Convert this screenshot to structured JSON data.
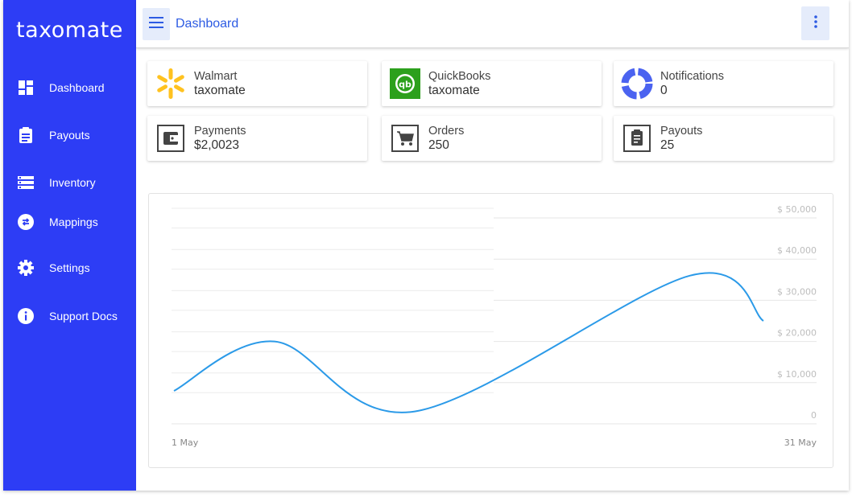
{
  "brand": {
    "logo_text": "taxomate"
  },
  "sidebar": {
    "items": [
      {
        "label": "Dashboard",
        "icon": "dashboard-icon"
      },
      {
        "label": "Payouts",
        "icon": "clipboard-icon"
      },
      {
        "label": "Inventory",
        "icon": "list-icon"
      },
      {
        "label": "Mappings",
        "icon": "swap-icon"
      },
      {
        "label": "Settings",
        "icon": "gear-icon"
      },
      {
        "label": "Support Docs",
        "icon": "info-icon"
      }
    ]
  },
  "header": {
    "title": "Dashboard"
  },
  "cards": [
    {
      "title": "Walmart",
      "value": "taxomate",
      "icon": "walmart-spark-icon"
    },
    {
      "title": "QuickBooks",
      "value": "taxomate",
      "icon": "quickbooks-icon"
    },
    {
      "title": "Notifications",
      "value": "0",
      "icon": "taxomate-logo-icon"
    },
    {
      "title": "Payments",
      "value": "$2,0023",
      "icon": "wallet-icon"
    },
    {
      "title": "Orders",
      "value": "250",
      "icon": "cart-icon"
    },
    {
      "title": "Payouts",
      "value": "25",
      "icon": "clipboard-icon"
    }
  ],
  "colors": {
    "sidebar": "#2d3df5",
    "accent": "#2d5be3",
    "line": "#2b9ae8",
    "walmart": "#ffc220",
    "quickbooks": "#2ca01c"
  },
  "chart_data": {
    "type": "line",
    "x": [
      "1 May",
      "8 May",
      "16 May",
      "24 May",
      "29 May"
    ],
    "x_tick_labels": [
      "1 May",
      "31 May"
    ],
    "series": [
      {
        "values": [
          8000,
          20000,
          3000,
          36000,
          25000
        ]
      }
    ],
    "y_tick_labels": [
      "$ 50,000",
      "$ 40,000",
      "$ 30,000",
      "$ 20,000",
      "$ 10,000",
      "0"
    ],
    "ylim": [
      0,
      50000
    ],
    "grid": true,
    "yaxis_position": "right"
  }
}
